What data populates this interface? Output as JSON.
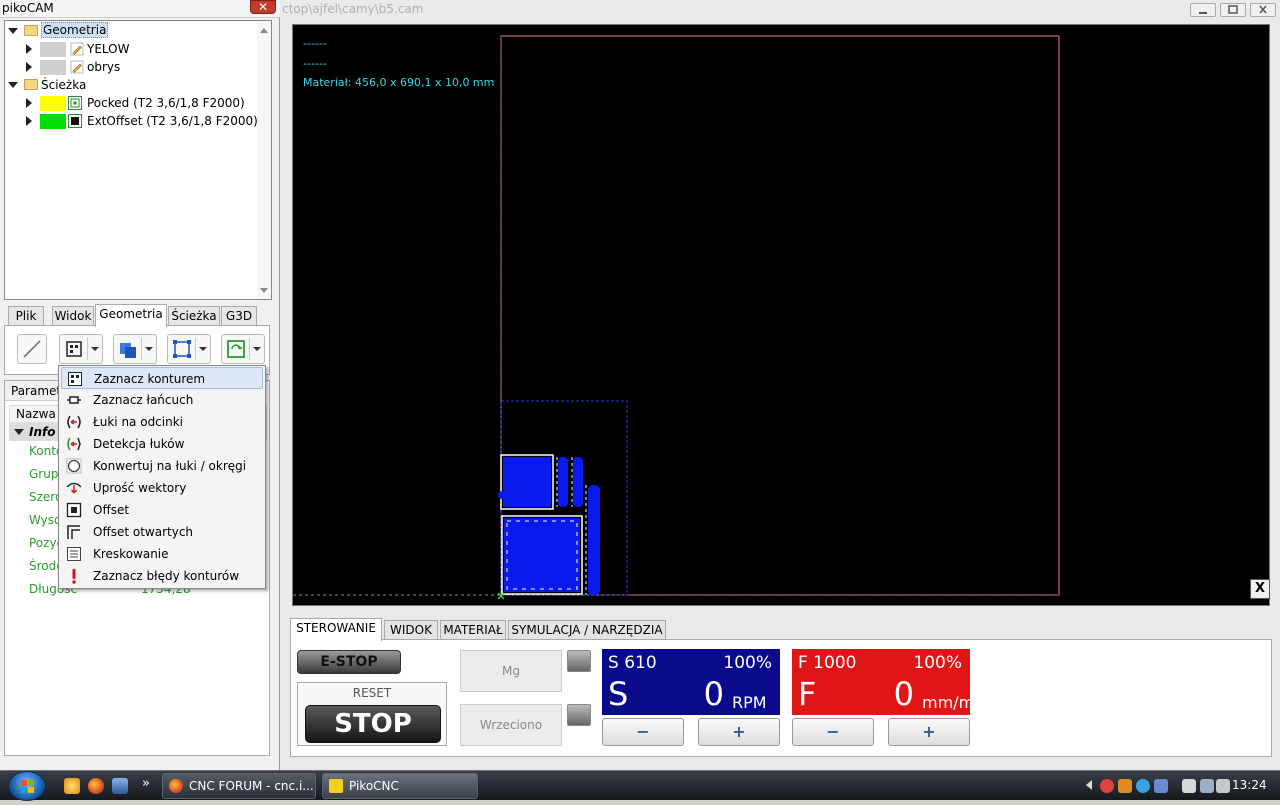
{
  "left_window": {
    "title": "pikoCAM",
    "close": "✕",
    "tree": [
      {
        "label": "Geometria"
      },
      {
        "label": "YELOW"
      },
      {
        "label": "obrys"
      },
      {
        "label": "Ścieżka"
      },
      {
        "label": "Pocked (T2 3,6/1,8 F2000)"
      },
      {
        "label": "ExtOffset (T2 3,6/1,8 F2000)"
      }
    ],
    "tabs": [
      "Plik",
      "Widok",
      "Geometria",
      "Ścieżka",
      "G3D"
    ],
    "params": {
      "tab": "Paramet",
      "header": "Nazwa",
      "info": "Info",
      "rows": [
        "Konto",
        "Grupy",
        "Szero",
        "Wyso",
        "Pozyc",
        "Środe",
        "Długość"
      ],
      "value_last": "1754,28"
    }
  },
  "menu": {
    "items": [
      {
        "label": "Zaznacz konturem",
        "icon": "select-contour-icon"
      },
      {
        "label": "Zaznacz łańcuch",
        "icon": "chain-icon"
      },
      {
        "label": "Łuki na odcinki",
        "icon": "arcs-to-lines-icon"
      },
      {
        "label": "Detekcja łuków",
        "icon": "detect-arcs-icon"
      },
      {
        "label": "Konwertuj na łuki / okręgi",
        "icon": "circle-icon"
      },
      {
        "label": "Uprość wektory",
        "icon": "simplify-icon"
      },
      {
        "label": "Offset",
        "icon": "offset-icon"
      },
      {
        "label": "Offset otwartych",
        "icon": "open-offset-icon"
      },
      {
        "label": "Kreskowanie",
        "icon": "hatch-icon"
      },
      {
        "label": "Zaznacz błędy konturów",
        "icon": "error-icon"
      }
    ]
  },
  "main_window": {
    "title": "ctop\\ajfel\\camy\\b5.cam",
    "viewport": {
      "line1": "------",
      "line2": "------",
      "material": "Materiał: 456,0 x 690,1 x 10,0 mm",
      "close": "X"
    },
    "control_tabs": [
      "STEROWANIE",
      "WIDOK",
      "MATERIAŁ",
      "SYMULACJA / NARZĘDZIA"
    ],
    "estop": "E-STOP",
    "reset": "RESET",
    "stop": "STOP",
    "mg": "Mg",
    "wrzeciono": "Wrzeciono",
    "spindle": {
      "set": "S 610",
      "pct": "100%",
      "letter": "S",
      "value": "0",
      "unit": "RPM",
      "color": "#0a0a8c"
    },
    "feed": {
      "set": "F 1000",
      "pct": "100%",
      "letter": "F",
      "value": "0",
      "unit": "mm/m",
      "color": "#e01515"
    },
    "minus": "−",
    "plus": "+"
  },
  "taskbar": {
    "tasks": [
      "CNC FORUM - cnc.i...",
      "PikoCNC"
    ],
    "more": "»",
    "clock": "13:24"
  }
}
